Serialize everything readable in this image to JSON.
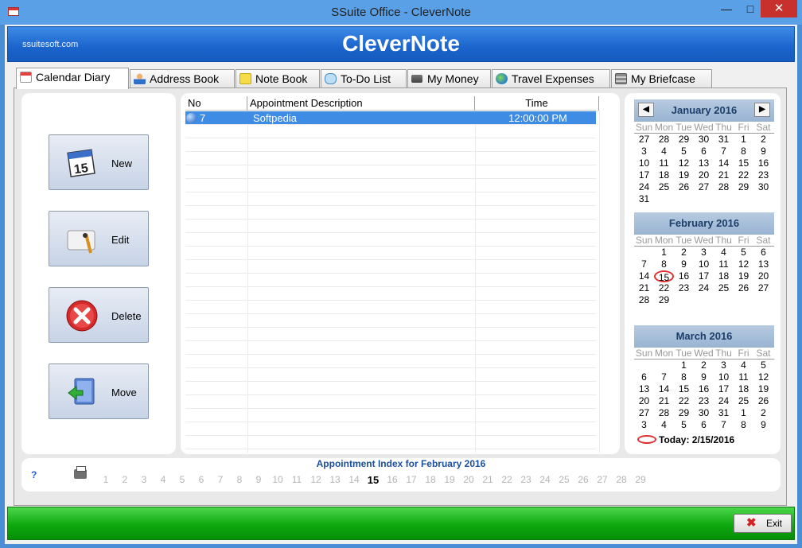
{
  "window": {
    "title": "SSuite Office - CleverNote",
    "minimize": "—",
    "maximize": "□",
    "close": "✕"
  },
  "header": {
    "site": "ssuitesoft.com",
    "title": "CleverNote"
  },
  "tabs": [
    {
      "label": "Calendar Diary",
      "icon": "calendar-icon",
      "active": true
    },
    {
      "label": "Address Book",
      "icon": "person-icon"
    },
    {
      "label": "Note Book",
      "icon": "notepad-icon"
    },
    {
      "label": "To-Do List",
      "icon": "speech-bubble-icon"
    },
    {
      "label": "My Money",
      "icon": "cart-icon"
    },
    {
      "label": "Travel Expenses",
      "icon": "globe-icon"
    },
    {
      "label": "My Briefcase",
      "icon": "cabinet-icon"
    }
  ],
  "actions": {
    "new": "New",
    "edit": "Edit",
    "delete": "Delete",
    "move": "Move",
    "calendar_icon_text": "15"
  },
  "list": {
    "columns": [
      "No",
      "Appointment Description",
      "Time"
    ],
    "rows": [
      {
        "no": "7",
        "description": "Softpedia",
        "time": "12:00:00 PM",
        "selected": true
      }
    ]
  },
  "calendars": [
    {
      "month": "January 2016",
      "prev": "◀",
      "next": "▶",
      "dow": [
        "Sun",
        "Mon",
        "Tue",
        "Wed",
        "Thu",
        "Fri",
        "Sat"
      ],
      "days": [
        "27",
        "28",
        "29",
        "30",
        "31",
        "1",
        "2",
        "3",
        "4",
        "5",
        "6",
        "7",
        "8",
        "9",
        "10",
        "11",
        "12",
        "13",
        "14",
        "15",
        "16",
        "17",
        "18",
        "19",
        "20",
        "21",
        "22",
        "23",
        "24",
        "25",
        "26",
        "27",
        "28",
        "29",
        "30",
        "31"
      ]
    },
    {
      "month": "February 2016",
      "dow": [
        "Sun",
        "Mon",
        "Tue",
        "Wed",
        "Thu",
        "Fri",
        "Sat"
      ],
      "days": [
        "",
        "1",
        "2",
        "3",
        "4",
        "5",
        "6",
        "7",
        "8",
        "9",
        "10",
        "11",
        "12",
        "13",
        "14",
        "15",
        "16",
        "17",
        "18",
        "19",
        "20",
        "21",
        "22",
        "23",
        "24",
        "25",
        "26",
        "27",
        "28",
        "29"
      ],
      "today": "15"
    },
    {
      "month": "March 2016",
      "dow": [
        "Sun",
        "Mon",
        "Tue",
        "Wed",
        "Thu",
        "Fri",
        "Sat"
      ],
      "days": [
        "",
        "",
        "1",
        "2",
        "3",
        "4",
        "5",
        "6",
        "7",
        "8",
        "9",
        "10",
        "11",
        "12",
        "13",
        "14",
        "15",
        "16",
        "17",
        "18",
        "19",
        "20",
        "21",
        "22",
        "23",
        "24",
        "25",
        "26",
        "27",
        "28",
        "29",
        "30",
        "31",
        "1",
        "2",
        "3",
        "4",
        "5",
        "6",
        "7",
        "8",
        "9"
      ]
    }
  ],
  "today_label": "Today: 2/15/2016",
  "index": {
    "title": "Appointment Index for February 2016",
    "help": "?",
    "days": [
      "1",
      "2",
      "3",
      "4",
      "5",
      "6",
      "7",
      "8",
      "9",
      "10",
      "11",
      "12",
      "13",
      "14",
      "15",
      "16",
      "17",
      "18",
      "19",
      "20",
      "21",
      "22",
      "23",
      "24",
      "25",
      "26",
      "27",
      "28",
      "29"
    ],
    "current": "15"
  },
  "footer": {
    "exit": "Exit"
  },
  "colors": {
    "header_blue": "#1a64cc",
    "selection_blue": "#3f8ce4",
    "footer_green": "#0ea90e",
    "today_red": "#e23030"
  }
}
